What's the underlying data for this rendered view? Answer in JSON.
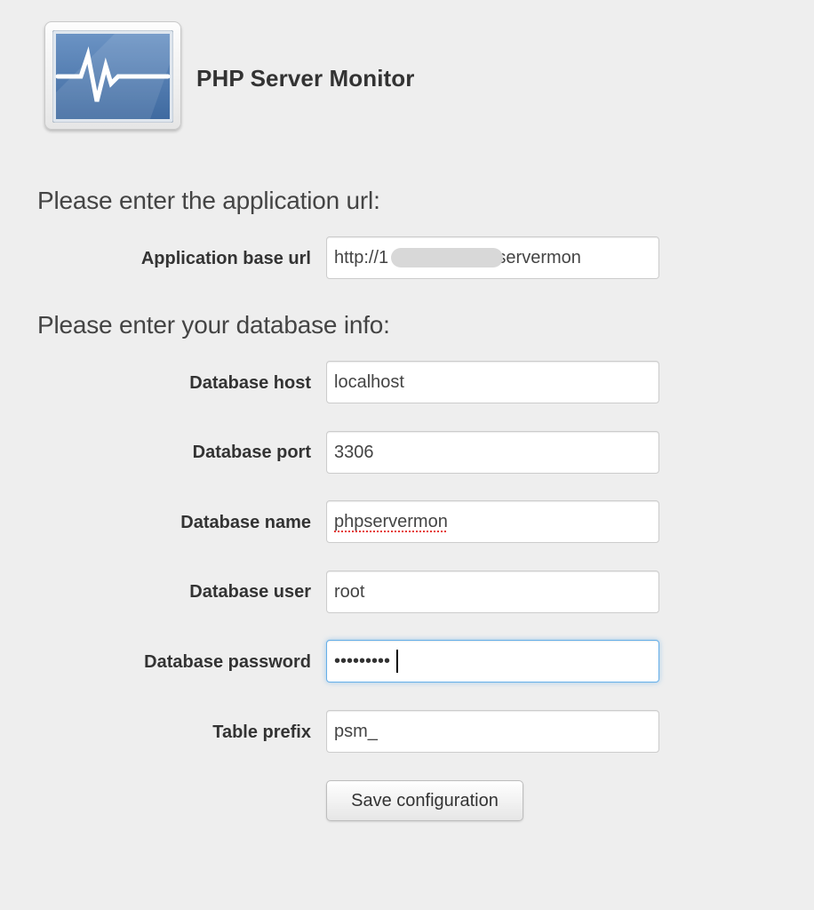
{
  "header": {
    "title": "PHP Server Monitor",
    "logo_icon": "server-monitor-logo-icon"
  },
  "sections": {
    "app_url_heading": "Please enter the application url:",
    "database_heading": "Please enter your database info:"
  },
  "fields": {
    "base_url": {
      "label": "Application base url",
      "value": "http://1               /phpservermon"
    },
    "db_host": {
      "label": "Database host",
      "value": "localhost"
    },
    "db_port": {
      "label": "Database port",
      "value": "3306"
    },
    "db_name": {
      "label": "Database name",
      "value": "phpservermon"
    },
    "db_user": {
      "label": "Database user",
      "value": "root"
    },
    "db_password": {
      "label": "Database password",
      "value": "•••••••••"
    },
    "table_prefix": {
      "label": "Table prefix",
      "value": "psm_"
    }
  },
  "buttons": {
    "save": "Save configuration"
  },
  "colors": {
    "background": "#eeeeee",
    "focus_ring": "#66afe9",
    "logo_screen": "#4f7bb1"
  }
}
